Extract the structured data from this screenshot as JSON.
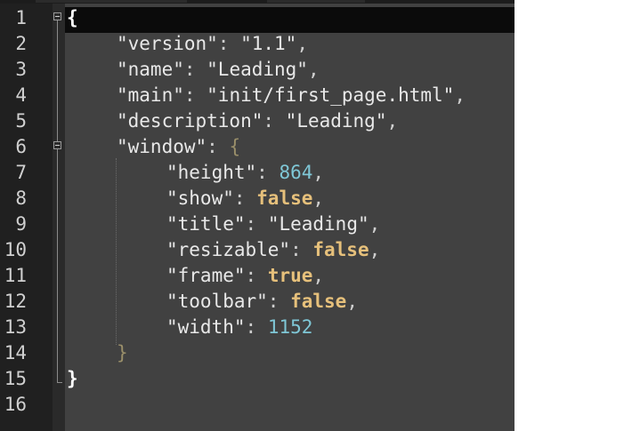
{
  "editor": {
    "line_numbers": [
      "1",
      "2",
      "3",
      "4",
      "5",
      "6",
      "7",
      "8",
      "9",
      "10",
      "11",
      "12",
      "13",
      "14",
      "15",
      "16"
    ],
    "lines": [
      {
        "text": "{"
      },
      {
        "key": "\"version\"",
        "sep": ": ",
        "value": "\"1.1\"",
        "vtype": "str",
        "trail": ","
      },
      {
        "key": "\"name\"",
        "sep": ": ",
        "value": "\"Leading\"",
        "vtype": "str",
        "trail": ","
      },
      {
        "key": "\"main\"",
        "sep": ": ",
        "value": "\"init/first_page.html\"",
        "vtype": "str",
        "trail": ","
      },
      {
        "key": "\"description\"",
        "sep": ": ",
        "value": "\"Leading\"",
        "vtype": "str",
        "trail": ","
      },
      {
        "key": "\"window\"",
        "sep": ": ",
        "value": "{",
        "vtype": "brace",
        "trail": ""
      },
      {
        "key": "\"height\"",
        "sep": ": ",
        "value": "864",
        "vtype": "num",
        "trail": ","
      },
      {
        "key": "\"show\"",
        "sep": ": ",
        "value": "false",
        "vtype": "bool",
        "trail": ","
      },
      {
        "key": "\"title\"",
        "sep": ": ",
        "value": "\"Leading\"",
        "vtype": "str",
        "trail": ","
      },
      {
        "key": "\"resizable\"",
        "sep": ": ",
        "value": "false",
        "vtype": "bool",
        "trail": ","
      },
      {
        "key": "\"frame\"",
        "sep": ": ",
        "value": "true",
        "vtype": "bool",
        "trail": ","
      },
      {
        "key": "\"toolbar\"",
        "sep": ": ",
        "value": "false",
        "vtype": "bool",
        "trail": ","
      },
      {
        "key": "\"width\"",
        "sep": ": ",
        "value": "1152",
        "vtype": "num",
        "trail": ""
      },
      {
        "text": "}"
      },
      {
        "text": "}"
      },
      {
        "text": ""
      }
    ]
  },
  "colors": {
    "editor_bg": "#414141",
    "gutter_bg": "#202020",
    "number": "#7fc7d6",
    "boolean": "#e6c07b"
  }
}
